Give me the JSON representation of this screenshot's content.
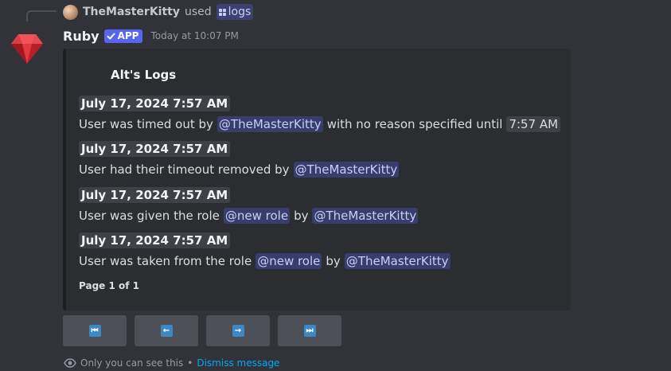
{
  "reply": {
    "username": "TheMasterKitty",
    "action": "used",
    "command": "logs"
  },
  "message": {
    "author": "Ruby",
    "badge": "APP",
    "timestamp": "Today at 10:07 PM"
  },
  "embed": {
    "title": "Alt's Logs",
    "entries": [
      {
        "date": "July 17, 2024 7:57 AM",
        "parts": [
          "User was timed out by",
          "@TheMasterKitty",
          "with no reason specified until",
          "7:57 AM"
        ]
      },
      {
        "date": "July 17, 2024 7:57 AM",
        "parts": [
          "User had their timeout removed by",
          "@TheMasterKitty"
        ]
      },
      {
        "date": "July 17, 2024 7:57 AM",
        "parts": [
          "User was given the role",
          "@new role",
          "by",
          "@TheMasterKitty"
        ]
      },
      {
        "date": "July 17, 2024 7:57 AM",
        "parts": [
          "User was taken from the role",
          "@new role",
          "by",
          "@TheMasterKitty"
        ]
      }
    ],
    "footer": "Page 1 of 1"
  },
  "buttons": [
    {
      "icon": "first-page-icon",
      "glyph": "⏮"
    },
    {
      "icon": "previous-page-icon",
      "glyph": "←"
    },
    {
      "icon": "next-page-icon",
      "glyph": "→"
    },
    {
      "icon": "last-page-icon",
      "glyph": "⏭"
    }
  ],
  "notice": {
    "text": "Only you can see this",
    "separator": "•",
    "dismiss": "Dismiss message"
  },
  "colors": {
    "background": "#313338",
    "embed_background": "#2b2d31",
    "mention_text": "#c9cdfb",
    "app_badge": "#5865f2",
    "link": "#00a8fc",
    "nav_glyph": "#3b88c3"
  }
}
